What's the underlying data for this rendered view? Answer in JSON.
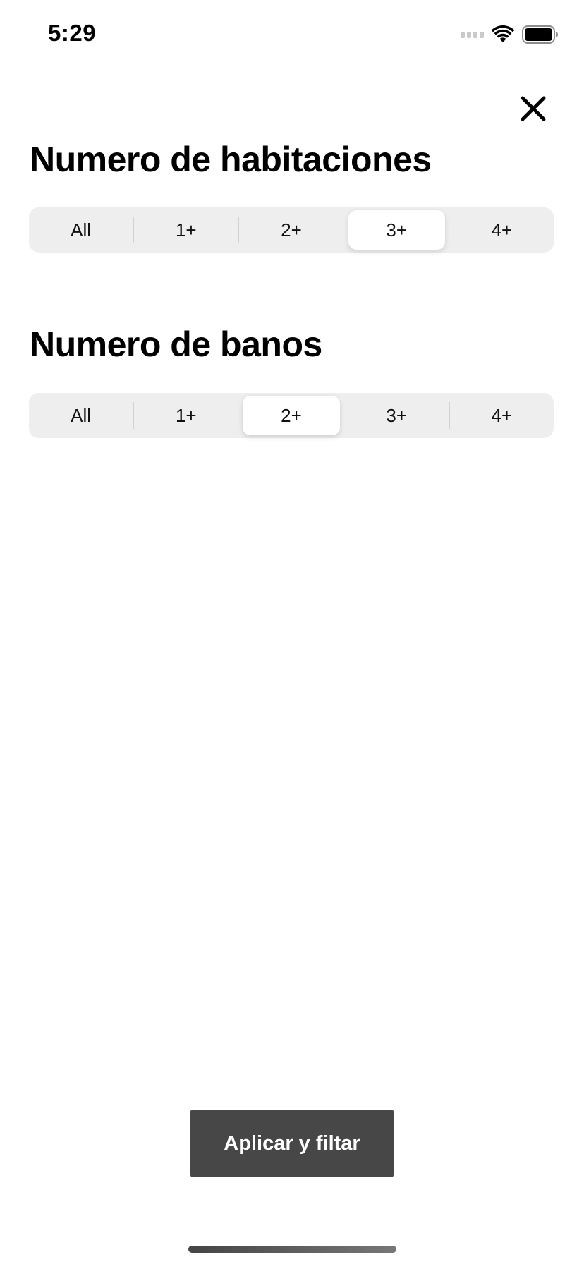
{
  "status_bar": {
    "time": "5:29",
    "icons": [
      "signal-icon",
      "wifi-icon",
      "battery-icon"
    ]
  },
  "close_icon": "close-icon",
  "bedrooms": {
    "title": "Numero de habitaciones",
    "options": [
      "All",
      "1+",
      "2+",
      "3+",
      "4+"
    ],
    "selected": "3+"
  },
  "bathrooms": {
    "title": "Numero de banos",
    "options": [
      "All",
      "1+",
      "2+",
      "3+",
      "4+"
    ],
    "selected": "2+"
  },
  "apply_button": {
    "label": "Aplicar y filtar",
    "color": "#474747"
  },
  "colors": {
    "segment_bg": "#eeeeee",
    "segment_selected": "#ffffff"
  }
}
